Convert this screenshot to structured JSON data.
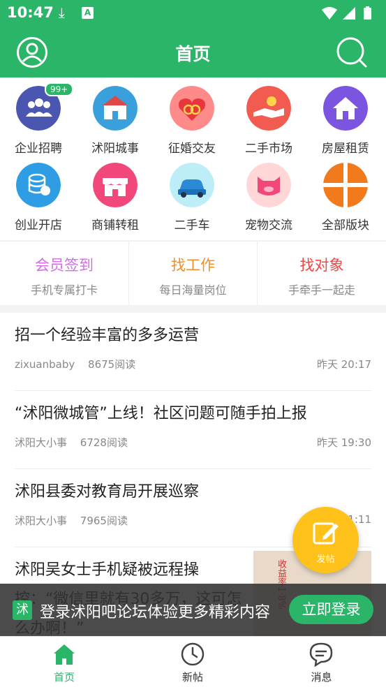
{
  "status_bar": {
    "time": "10:47"
  },
  "header": {
    "title": "首页"
  },
  "grid": [
    {
      "label": "企业招聘",
      "badge": "99+",
      "color": "#4a56b0"
    },
    {
      "label": "沭阳城事",
      "color": "#3aa0dc"
    },
    {
      "label": "征婚交友",
      "color": "#ff8a8a"
    },
    {
      "label": "二手市场",
      "color": "#f25b4f"
    },
    {
      "label": "房屋租赁",
      "color": "#7b55e0"
    },
    {
      "label": "创业开店",
      "color": "#2e9de3"
    },
    {
      "label": "商铺转租",
      "color": "#f2477a"
    },
    {
      "label": "二手车",
      "color": "#6ad0ea"
    },
    {
      "label": "宠物交流",
      "color": "#ffd7d7"
    },
    {
      "label": "全部版块",
      "color": "#f07a1c"
    }
  ],
  "quick": [
    {
      "title": "会员签到",
      "sub": "手机专属打卡",
      "color": "#d46be8"
    },
    {
      "title": "找工作",
      "sub": "每日海量岗位",
      "color": "#f0902a"
    },
    {
      "title": "找对象",
      "sub": "手牵手一起走",
      "color": "#ef4545"
    }
  ],
  "posts": [
    {
      "title": "招一个经验丰富的多多运营",
      "author": "zixuanbaby",
      "reads": "8675阅读",
      "time": "昨天 20:17"
    },
    {
      "title": "“沭阳微城管”上线！社区问题可随手拍上报",
      "author": "沭阳大小事",
      "reads": "6728阅读",
      "time": "昨天 19:30"
    },
    {
      "title": "沭阳县委对教育局开展巡察",
      "author": "沭阳大小事",
      "reads": "7965阅读",
      "time": "1:11"
    },
    {
      "title": "沭阳吴女士手机疑被远程操控：“微信里就有30多万，这可怎么办啊！”"
    }
  ],
  "thumb_text": "收益率1·8%",
  "fab": {
    "label": "发帖"
  },
  "banner": {
    "logo": "沭",
    "text": "登录沭阳吧论坛体验更多精彩内容",
    "button": "立即登录"
  },
  "tabs": [
    {
      "label": "首页",
      "active": true
    },
    {
      "label": "新帖"
    },
    {
      "label": "消息"
    }
  ],
  "colors": {
    "brand": "#2bb568",
    "fab": "#ffc21a"
  }
}
